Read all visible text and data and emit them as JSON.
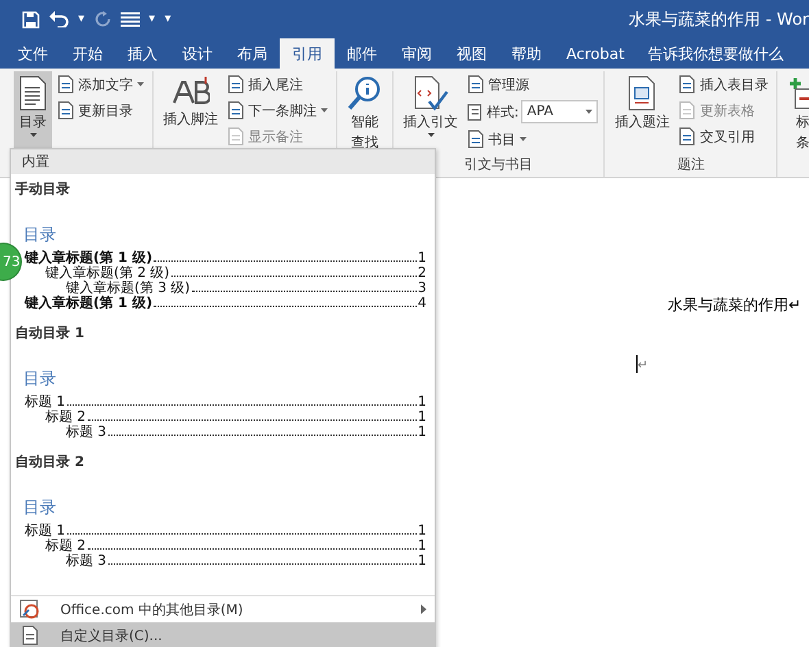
{
  "window": {
    "title": "水果与蔬菜的作用 - Wor"
  },
  "quick_access": {
    "undo_dropdown": "▾",
    "layout_dropdown": "▾",
    "customize": "▾"
  },
  "tabs": [
    {
      "label": "文件",
      "selected": false
    },
    {
      "label": "开始",
      "selected": false
    },
    {
      "label": "插入",
      "selected": false
    },
    {
      "label": "设计",
      "selected": false
    },
    {
      "label": "布局",
      "selected": false
    },
    {
      "label": "引用",
      "selected": true
    },
    {
      "label": "邮件",
      "selected": false
    },
    {
      "label": "审阅",
      "selected": false
    },
    {
      "label": "视图",
      "selected": false
    },
    {
      "label": "帮助",
      "selected": false
    },
    {
      "label": "Acrobat",
      "selected": false
    }
  ],
  "tell_me": {
    "placeholder": "告诉我你想要做什么"
  },
  "ribbon_groups": [
    {
      "large": [
        {
          "lines": [
            "目录"
          ],
          "dropdown": true,
          "pressed": true
        }
      ],
      "small": [
        {
          "kind": "button",
          "label": "添加文字",
          "dropdown": true,
          "disabled": false
        },
        {
          "kind": "button",
          "label": "更新目录",
          "dropdown": false,
          "disabled": false
        }
      ]
    },
    {
      "large": [
        {
          "lines": [
            "插入脚注"
          ],
          "dropdown": false,
          "pressed": false
        }
      ],
      "small": [
        {
          "kind": "button",
          "label": "插入尾注",
          "dropdown": false,
          "disabled": false
        },
        {
          "kind": "button",
          "label": "下一条脚注",
          "dropdown": true,
          "disabled": false
        },
        {
          "kind": "button",
          "label": "显示备注",
          "dropdown": false,
          "disabled": true
        }
      ]
    },
    {
      "large": [
        {
          "lines": [
            "智能",
            "查找"
          ],
          "dropdown": false,
          "pressed": false
        }
      ]
    },
    {
      "label": "引文与书目",
      "large": [
        {
          "lines": [
            "插入引文"
          ],
          "dropdown": true,
          "pressed": false
        }
      ],
      "small": [
        {
          "kind": "button",
          "label": "管理源",
          "dropdown": false,
          "disabled": false
        },
        {
          "kind": "combo",
          "label": "样式:",
          "value": "APA"
        },
        {
          "kind": "button",
          "label": "书目",
          "dropdown": true,
          "disabled": false
        }
      ]
    },
    {
      "label": "题注",
      "large": [
        {
          "lines": [
            "插入题注"
          ],
          "dropdown": false,
          "pressed": false
        }
      ],
      "small": [
        {
          "kind": "button",
          "label": "插入表目录",
          "dropdown": false,
          "disabled": false
        },
        {
          "kind": "button",
          "label": "更新表格",
          "dropdown": false,
          "disabled": true
        },
        {
          "kind": "button",
          "label": "交叉引用",
          "dropdown": false,
          "disabled": false
        }
      ]
    },
    {
      "large": [
        {
          "lines": [
            "标",
            "条"
          ],
          "dropdown": false,
          "pressed": false
        }
      ]
    }
  ],
  "document": {
    "title_line": "水果与蔬菜的作用↵",
    "empty_line": "↵"
  },
  "badge": "73",
  "toc_menu": {
    "header": "内置",
    "sections": [
      {
        "title": "手动目录",
        "heading": "目录",
        "entries": [
          {
            "text": "键入章标题(第 1 级)",
            "page": "1",
            "children": [
              {
                "text": "键入章标题(第 2 级)",
                "page": "2",
                "children": [
                  {
                    "text": "键入章标题(第 3 级)",
                    "page": "3"
                  }
                ]
              }
            ]
          },
          {
            "text": "键入章标题(第 1 级)",
            "page": "4"
          }
        ]
      },
      {
        "title": "自动目录 1",
        "heading": "目录",
        "entries": [
          {
            "text": "标题 1",
            "page": "1",
            "children": [
              {
                "text": "标题 2",
                "page": "1",
                "children": [
                  {
                    "text": "标题 3",
                    "page": "1"
                  }
                ]
              }
            ]
          }
        ]
      },
      {
        "title": "自动目录 2",
        "heading": "目录",
        "entries": [
          {
            "text": "标题 1",
            "page": "1",
            "children": [
              {
                "text": "标题 2",
                "page": "1",
                "children": [
                  {
                    "text": "标题 3",
                    "page": "1"
                  }
                ]
              }
            ]
          }
        ]
      }
    ],
    "commands": [
      {
        "label": "Office.com 中的其他目录(M)",
        "submenu": true,
        "selected": false
      },
      {
        "label": "自定义目录(C)...",
        "submenu": false,
        "selected": true
      }
    ]
  }
}
